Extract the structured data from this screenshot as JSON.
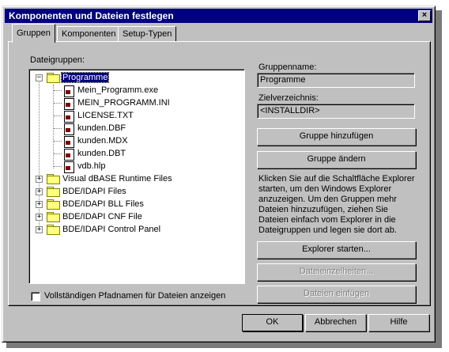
{
  "window": {
    "title": "Komponenten und Dateien festlegen",
    "close_glyph": "×"
  },
  "tabs": [
    {
      "label": "Gruppen",
      "active": true
    },
    {
      "label": "Komponenten",
      "active": false
    },
    {
      "label": "Setup-Typen",
      "active": false
    }
  ],
  "groups_panel": {
    "label": "Dateigruppen:",
    "tree": [
      {
        "label": "Programme",
        "expanded": true,
        "selected": true,
        "files": [
          "Mein_Programm.exe",
          "MEIN_PROGRAMM.INI",
          "LICENSE.TXT",
          "kunden.DBF",
          "kunden.MDX",
          "kunden.DBT",
          "vdb.hlp"
        ]
      },
      {
        "label": "Visual dBASE Runtime Files",
        "expanded": false
      },
      {
        "label": "BDE/IDAPI Files",
        "expanded": false
      },
      {
        "label": "BDE/IDAPI BLL Files",
        "expanded": false
      },
      {
        "label": "BDE/IDAPI CNF File",
        "expanded": false
      },
      {
        "label": "BDE/IDAPI Control Panel",
        "expanded": false
      }
    ],
    "expand_glyph": "+",
    "collapse_glyph": "−",
    "show_full_paths": {
      "label": "Vollständigen Pfadnamen für Dateien anzeigen",
      "checked": false
    }
  },
  "details": {
    "group_name_label": "Gruppenname:",
    "group_name_value": "Programme",
    "target_dir_label": "Zielverzeichnis:",
    "target_dir_value": "<INSTALLDIR>",
    "add_group": "Gruppe hinzufügen",
    "change_group": "Gruppe ändern",
    "help_text": "Klicken Sie auf die Schaltfläche Explorer starten, um den Windows Explorer anzuzeigen. Um den Gruppen mehr Dateien hinzuzufügen, ziehen Sie Dateien einfach vom Explorer in die Dateigruppen und legen sie dort ab.",
    "start_explorer": "Explorer starten...",
    "file_details": "Dateieinzelheiten...",
    "insert_files": "Dateien einfügen"
  },
  "footer": {
    "ok": "OK",
    "cancel": "Abbrechen",
    "help": "Hilfe"
  },
  "colors": {
    "titlebar": "#000080",
    "face": "#c0c0c0",
    "selection": "#000080",
    "folder": "#ffff80"
  }
}
